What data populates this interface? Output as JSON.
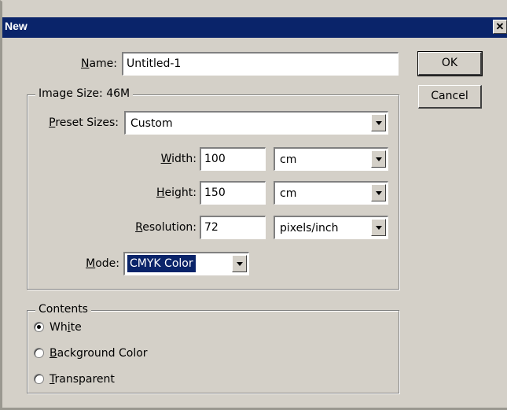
{
  "window": {
    "title": "New",
    "close_glyph": "✕"
  },
  "name": {
    "label_pre": "",
    "label_ul": "N",
    "label_post": "ame:",
    "value": "Untitled-1"
  },
  "image_size": {
    "legend": "Image Size: 46M"
  },
  "preset": {
    "label_ul": "P",
    "label_post": "reset Sizes:",
    "value": "Custom"
  },
  "width": {
    "label_ul": "W",
    "label_post": "idth:",
    "value": "100",
    "unit": "cm"
  },
  "height": {
    "label_ul": "H",
    "label_post": "eight:",
    "value": "150",
    "unit": "cm"
  },
  "resolution": {
    "label_ul": "R",
    "label_post": "esolution:",
    "value": "72",
    "unit": "pixels/inch"
  },
  "mode": {
    "label_ul": "M",
    "label_post": "ode:",
    "value": "CMYK Color"
  },
  "contents": {
    "legend": "Contents",
    "options": [
      {
        "pre": "Wh",
        "ul": "i",
        "post": "te",
        "checked": true
      },
      {
        "pre": "",
        "ul": "B",
        "post": "ackground Color",
        "checked": false
      },
      {
        "pre": "",
        "ul": "T",
        "post": "ransparent",
        "checked": false
      }
    ]
  },
  "buttons": {
    "ok": "OK",
    "cancel": "Cancel"
  }
}
